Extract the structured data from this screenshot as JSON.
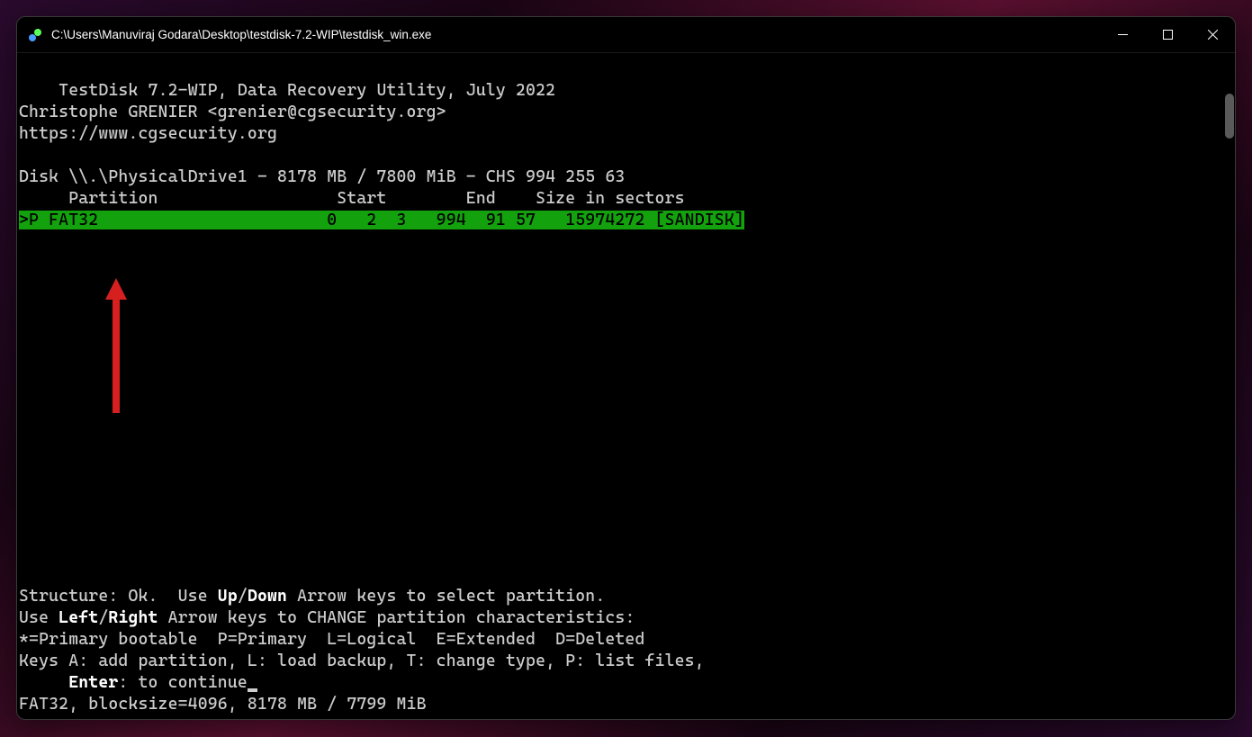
{
  "window": {
    "title": "C:\\Users\\Manuviraj Godara\\Desktop\\testdisk-7.2-WIP\\testdisk_win.exe"
  },
  "header": {
    "line1": "TestDisk 7.2-WIP, Data Recovery Utility, July 2022",
    "line2": "Christophe GRENIER <grenier@cgsecurity.org>",
    "line3": "https://www.cgsecurity.org"
  },
  "disk": {
    "info": "Disk \\\\.\\PhysicalDrive1 - 8178 MB / 7800 MiB - CHS 994 255 63",
    "columns": "     Partition                  Start        End    Size in sectors"
  },
  "partition": {
    "row": ">P FAT32                       0   2  3   994  91 57   15974272 [SANDISK]"
  },
  "instructions": {
    "line1_prefix": "Structure: Ok.  Use ",
    "line1_bold1": "Up",
    "line1_sep": "/",
    "line1_bold2": "Down",
    "line1_suffix": " Arrow keys to select partition.",
    "line2_prefix": "Use ",
    "line2_bold1": "Left",
    "line2_sep": "/",
    "line2_bold2": "Right",
    "line2_suffix": " Arrow keys to CHANGE partition characteristics:",
    "line3": "*=Primary bootable  P=Primary  L=Logical  E=Extended  D=Deleted",
    "line4": "Keys A: add partition, L: load backup, T: change type, P: list files,",
    "line5_prefix": "     ",
    "line5_bold": "Enter",
    "line5_suffix": ": to continue",
    "line6": "FAT32, blocksize=4096, 8178 MB / 7799 MiB"
  }
}
